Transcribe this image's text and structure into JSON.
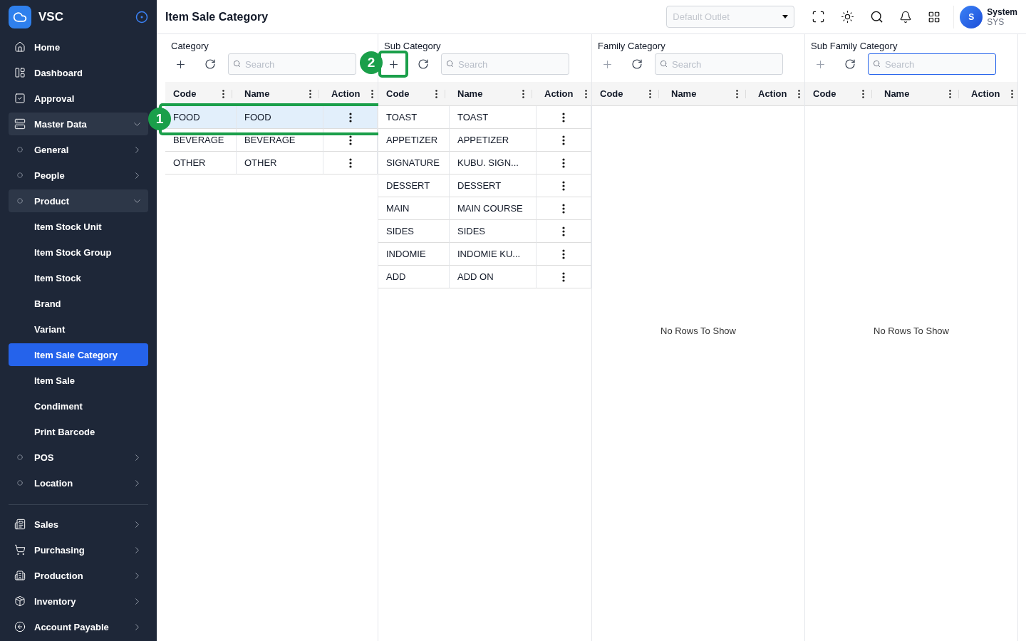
{
  "sidebar": {
    "brand": "VSC",
    "pinned": true,
    "sections": [
      {
        "items": [
          {
            "label": "Home",
            "kind": "link"
          },
          {
            "label": "Dashboard",
            "kind": "link"
          },
          {
            "label": "Approval",
            "kind": "link"
          },
          {
            "label": "Master Data",
            "kind": "group",
            "expanded": true,
            "children": [
              {
                "label": "General",
                "expanded": false
              },
              {
                "label": "People",
                "expanded": false
              },
              {
                "label": "Product",
                "expanded": true,
                "children": [
                  {
                    "label": "Item Stock Unit",
                    "selected": false
                  },
                  {
                    "label": "Item Stock Group",
                    "selected": false
                  },
                  {
                    "label": "Item Stock",
                    "selected": false
                  },
                  {
                    "label": "Brand",
                    "selected": false
                  },
                  {
                    "label": "Variant",
                    "selected": false
                  },
                  {
                    "label": "Item Sale Category",
                    "selected": true
                  },
                  {
                    "label": "Item Sale",
                    "selected": false
                  },
                  {
                    "label": "Condiment",
                    "selected": false
                  },
                  {
                    "label": "Print Barcode",
                    "selected": false
                  }
                ]
              },
              {
                "label": "POS",
                "expanded": false
              },
              {
                "label": "Location",
                "expanded": false
              }
            ]
          }
        ]
      },
      {
        "items": [
          {
            "label": "Sales",
            "expanded": false
          },
          {
            "label": "Purchasing",
            "expanded": false
          },
          {
            "label": "Production",
            "expanded": false
          },
          {
            "label": "Inventory",
            "expanded": false
          },
          {
            "label": "Account Payable",
            "expanded": false
          }
        ]
      }
    ]
  },
  "header": {
    "title": "Item Sale Category",
    "outlet": {
      "placeholder": "Default Outlet",
      "disabled": true
    },
    "user": {
      "initial": "S",
      "name": "System",
      "code": "SYS"
    }
  },
  "panels": [
    {
      "title": "Category",
      "add_disabled": false,
      "search": {
        "placeholder": "Search",
        "focused": false
      },
      "columns": [
        "Code",
        "Name",
        "Action"
      ],
      "annotation": "1",
      "rows": [
        {
          "code": "FOOD",
          "name": "FOOD",
          "selected": true
        },
        {
          "code": "BEVERAGE",
          "name": "BEVERAGE",
          "selected": false
        },
        {
          "code": "OTHER",
          "name": "OTHER",
          "selected": false
        }
      ]
    },
    {
      "title": "Sub Category",
      "add_disabled": false,
      "search": {
        "placeholder": "Search",
        "focused": false
      },
      "columns": [
        "Code",
        "Name",
        "Action"
      ],
      "annotation": "2",
      "rows": [
        {
          "code": "TOAST",
          "name": "TOAST",
          "selected": false
        },
        {
          "code": "APPETIZER",
          "name": "APPETIZER",
          "selected": false
        },
        {
          "code": "SIGNATURE",
          "name": "KUBU. SIGN...",
          "selected": false
        },
        {
          "code": "DESSERT",
          "name": "DESSERT",
          "selected": false
        },
        {
          "code": "MAIN",
          "name": "MAIN COURSE",
          "selected": false
        },
        {
          "code": "SIDES",
          "name": "SIDES",
          "selected": false
        },
        {
          "code": "INDOMIE",
          "name": "INDOMIE KU...",
          "selected": false
        },
        {
          "code": "ADD",
          "name": "ADD ON",
          "selected": false
        }
      ]
    },
    {
      "title": "Family Category",
      "add_disabled": true,
      "search": {
        "placeholder": "Search",
        "focused": false
      },
      "columns": [
        "Code",
        "Name",
        "Action"
      ],
      "empty_message": "No Rows To Show"
    },
    {
      "title": "Sub Family Category",
      "add_disabled": true,
      "search": {
        "placeholder": "Search",
        "focused": true
      },
      "columns": [
        "Code",
        "Name",
        "Action"
      ],
      "empty_message": "No Rows To Show"
    }
  ]
}
